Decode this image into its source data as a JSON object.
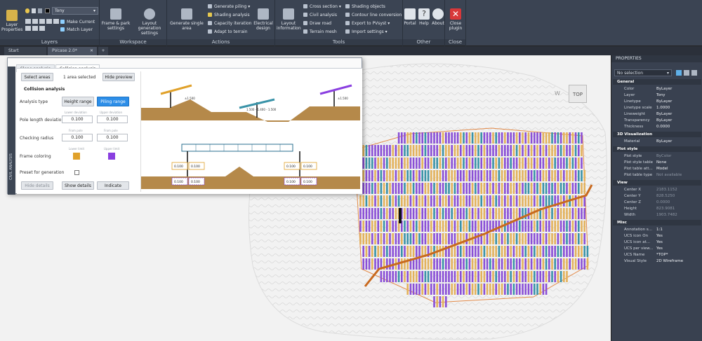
{
  "ribbon": {
    "layers": {
      "properties_label": "Layer Properties",
      "current_layer": "Tony",
      "make_current": "Make Current",
      "match_layer": "Match Layer",
      "group_label": "Layers"
    },
    "workspace": {
      "frame_park": "Frame & park settings",
      "layout_generation": "Layout generation settings",
      "group_label": "Workspace"
    },
    "actions": {
      "generate_single": "Generate single area",
      "generate_piling": "Generate piling",
      "shading_analysis": "Shading analysis",
      "capacity_iteration": "Capacity iteration",
      "adapt_terrain": "Adapt to terrain",
      "electrical_design": "Electrical design",
      "group_label": "Actions"
    },
    "tools": {
      "layout_information": "Layout information",
      "cross_section": "Cross section",
      "civil_analysis": "Civil analysis",
      "draw_road": "Draw road",
      "terrain_mesh": "Terrain mesh",
      "shading_objects": "Shading objects",
      "contour_conversion": "Contour line conversion",
      "export_pvsyst": "Export to PVsyst",
      "import_settings": "Import settings",
      "group_label": "Tools"
    },
    "other": {
      "portal": "Portal",
      "help": "Help",
      "about": "About",
      "group_label": "Other"
    },
    "close": {
      "close_plugin": "Close plugin",
      "group_label": "Close"
    }
  },
  "doc_tabs": [
    "Start",
    "PVcase 2.0*"
  ],
  "viewcube": {
    "top": "TOP",
    "west": "W"
  },
  "dialog": {
    "tabs": [
      "Slope analysis",
      "Collision analysis"
    ],
    "side_label": "CIVIL ANALYSIS",
    "select_areas": "Select areas",
    "areas_selected": "1 area selected",
    "hide_preview": "Hide preview",
    "section_title": "Collision analysis",
    "analysis_type_label": "Analysis type",
    "height_range": "Height range",
    "piling_range": "Piling range",
    "lower_deviation": "Lower deviation",
    "upper_deviation": "Upper deviation",
    "pole_length_label": "Pole length deviation",
    "pole_lower": "0.100",
    "pole_upper": "0.100",
    "from_pole_1": "From pole",
    "from_pole_2": "From pole",
    "checking_radius_label": "Checking radius",
    "radius_1": "0.100",
    "radius_2": "0.100",
    "lower_limit": "Lower limit",
    "upper_limit": "Upper limit",
    "frame_coloring_label": "Frame coloring",
    "preset_label": "Preset for generation",
    "hide_details": "Hide details",
    "show_details": "Show details",
    "indicate": "Indicate",
    "preview": {
      "label_1": "±1.500",
      "label_2": "1.500 - 1.400 - 1.500",
      "label_3": "±1.500",
      "box_values": [
        "0.100",
        "0.100",
        "0.100",
        "0.100"
      ],
      "bottom_values": [
        "0.100",
        "0.100",
        "0.100",
        "0.100"
      ]
    }
  },
  "properties": {
    "title": "PROPERTIES",
    "selection": "No selection",
    "sections": {
      "general": "General",
      "visualization": "3D Visualization",
      "plot_style": "Plot style",
      "view": "View",
      "misc": "Misc"
    },
    "general": [
      {
        "k": "Color",
        "v": "ByLayer"
      },
      {
        "k": "Layer",
        "v": "Tony"
      },
      {
        "k": "Linetype",
        "v": "ByLayer"
      },
      {
        "k": "Linetype scale",
        "v": "1.0000"
      },
      {
        "k": "Lineweight",
        "v": "ByLayer"
      },
      {
        "k": "Transparency",
        "v": "ByLayer"
      },
      {
        "k": "Thickness",
        "v": "0.0000"
      }
    ],
    "visualization": [
      {
        "k": "Material",
        "v": "ByLayer"
      }
    ],
    "plot_style": [
      {
        "k": "Plot style",
        "v": "ByColor"
      },
      {
        "k": "Plot style table",
        "v": "None"
      },
      {
        "k": "Plot table att...",
        "v": "Model"
      },
      {
        "k": "Plot table type",
        "v": "Not available"
      }
    ],
    "view": [
      {
        "k": "Center X",
        "v": "2183.1152"
      },
      {
        "k": "Center Y",
        "v": "828.5250"
      },
      {
        "k": "Center Z",
        "v": "0.0000"
      },
      {
        "k": "Height",
        "v": "823.9081"
      },
      {
        "k": "Width",
        "v": "1903.7482"
      }
    ],
    "misc": [
      {
        "k": "Annotation s...",
        "v": "1:1"
      },
      {
        "k": "UCS icon On",
        "v": "Yes"
      },
      {
        "k": "UCS icon at...",
        "v": "Yes"
      },
      {
        "k": "UCS per view...",
        "v": "Yes"
      },
      {
        "k": "UCS Name",
        "v": "*TOP*"
      },
      {
        "k": "Visual Style",
        "v": "2D Wireframe"
      }
    ]
  },
  "colors": {
    "purple": "#8a4fd6",
    "yellow": "#e3b25c",
    "teal": "#3a93a8",
    "road": "#c8691e",
    "boundary": "#e38b4a",
    "blue_button": "#2d8ee8",
    "swatch_1": "#e0a12a",
    "swatch_2": "#8a3fe0",
    "terrain": "#b5894a"
  }
}
